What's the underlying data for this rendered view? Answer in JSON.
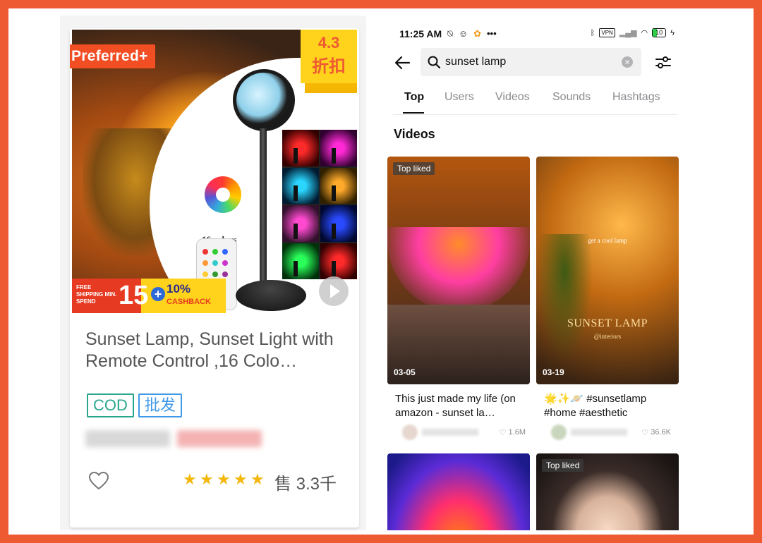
{
  "product": {
    "badge_preferred": "Preferred+",
    "discount_rate": "4.3",
    "discount_text": "折扣",
    "colors_caption": "16 colors",
    "promo": {
      "free_shipping": "FREE SHIPPING MIN. SPEND",
      "amount": "15",
      "plus": "+",
      "cashback_value": "10%",
      "cashback_label": "CASHBACK"
    },
    "title": "Sunset Lamp, Sunset Light with Remote Control ,16 Colo…",
    "tags": [
      "COD",
      "批发"
    ],
    "rating_stars": 5,
    "sold": "售 3.3千"
  },
  "phone": {
    "status": {
      "time": "11:25 AM",
      "more": "•••",
      "vpn": "VPN",
      "battery": "10"
    },
    "search": {
      "query": "sunset lamp"
    },
    "tabs": [
      "Top",
      "Users",
      "Videos",
      "Sounds",
      "Hashtags"
    ],
    "active_tab": "Top",
    "section_title": "Videos",
    "videos": [
      {
        "badge": "Top liked",
        "date": "03-05",
        "caption": "This just made my life (on amazon - sunset la…",
        "likes": "1.6M"
      },
      {
        "badge": "",
        "date": "03-19",
        "overlay_small": "get a cool lamp",
        "overlay_title": "SUNSET LAMP",
        "overlay_handle": "@interiors",
        "caption": "🌟✨🪐 #sunsetlamp #home #aesthetic",
        "likes": "36.6K"
      },
      {
        "badge": ""
      },
      {
        "badge": "Top liked"
      }
    ]
  },
  "colors": {
    "frame": "#ee5a32",
    "star": "#f4b70c",
    "cod": "#2aa68e",
    "wholesale": "#3f98e8"
  }
}
